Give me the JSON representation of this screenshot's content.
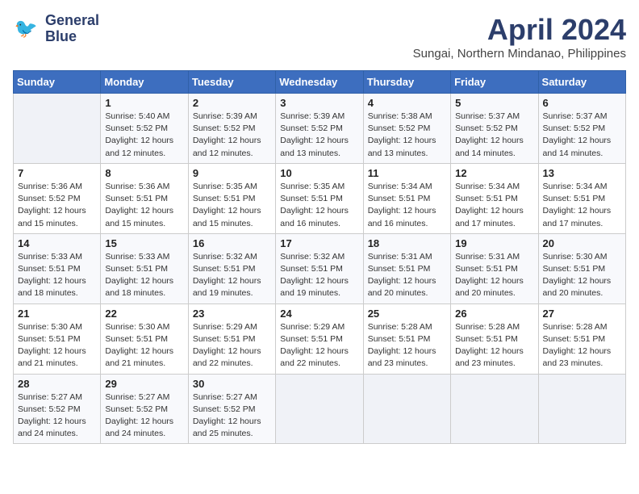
{
  "header": {
    "logo_line1": "General",
    "logo_line2": "Blue",
    "title": "April 2024",
    "subtitle": "Sungai, Northern Mindanao, Philippines"
  },
  "weekdays": [
    "Sunday",
    "Monday",
    "Tuesday",
    "Wednesday",
    "Thursday",
    "Friday",
    "Saturday"
  ],
  "weeks": [
    [
      {
        "num": "",
        "info": ""
      },
      {
        "num": "1",
        "info": "Sunrise: 5:40 AM\nSunset: 5:52 PM\nDaylight: 12 hours\nand 12 minutes."
      },
      {
        "num": "2",
        "info": "Sunrise: 5:39 AM\nSunset: 5:52 PM\nDaylight: 12 hours\nand 12 minutes."
      },
      {
        "num": "3",
        "info": "Sunrise: 5:39 AM\nSunset: 5:52 PM\nDaylight: 12 hours\nand 13 minutes."
      },
      {
        "num": "4",
        "info": "Sunrise: 5:38 AM\nSunset: 5:52 PM\nDaylight: 12 hours\nand 13 minutes."
      },
      {
        "num": "5",
        "info": "Sunrise: 5:37 AM\nSunset: 5:52 PM\nDaylight: 12 hours\nand 14 minutes."
      },
      {
        "num": "6",
        "info": "Sunrise: 5:37 AM\nSunset: 5:52 PM\nDaylight: 12 hours\nand 14 minutes."
      }
    ],
    [
      {
        "num": "7",
        "info": "Sunrise: 5:36 AM\nSunset: 5:52 PM\nDaylight: 12 hours\nand 15 minutes."
      },
      {
        "num": "8",
        "info": "Sunrise: 5:36 AM\nSunset: 5:51 PM\nDaylight: 12 hours\nand 15 minutes."
      },
      {
        "num": "9",
        "info": "Sunrise: 5:35 AM\nSunset: 5:51 PM\nDaylight: 12 hours\nand 15 minutes."
      },
      {
        "num": "10",
        "info": "Sunrise: 5:35 AM\nSunset: 5:51 PM\nDaylight: 12 hours\nand 16 minutes."
      },
      {
        "num": "11",
        "info": "Sunrise: 5:34 AM\nSunset: 5:51 PM\nDaylight: 12 hours\nand 16 minutes."
      },
      {
        "num": "12",
        "info": "Sunrise: 5:34 AM\nSunset: 5:51 PM\nDaylight: 12 hours\nand 17 minutes."
      },
      {
        "num": "13",
        "info": "Sunrise: 5:34 AM\nSunset: 5:51 PM\nDaylight: 12 hours\nand 17 minutes."
      }
    ],
    [
      {
        "num": "14",
        "info": "Sunrise: 5:33 AM\nSunset: 5:51 PM\nDaylight: 12 hours\nand 18 minutes."
      },
      {
        "num": "15",
        "info": "Sunrise: 5:33 AM\nSunset: 5:51 PM\nDaylight: 12 hours\nand 18 minutes."
      },
      {
        "num": "16",
        "info": "Sunrise: 5:32 AM\nSunset: 5:51 PM\nDaylight: 12 hours\nand 19 minutes."
      },
      {
        "num": "17",
        "info": "Sunrise: 5:32 AM\nSunset: 5:51 PM\nDaylight: 12 hours\nand 19 minutes."
      },
      {
        "num": "18",
        "info": "Sunrise: 5:31 AM\nSunset: 5:51 PM\nDaylight: 12 hours\nand 20 minutes."
      },
      {
        "num": "19",
        "info": "Sunrise: 5:31 AM\nSunset: 5:51 PM\nDaylight: 12 hours\nand 20 minutes."
      },
      {
        "num": "20",
        "info": "Sunrise: 5:30 AM\nSunset: 5:51 PM\nDaylight: 12 hours\nand 20 minutes."
      }
    ],
    [
      {
        "num": "21",
        "info": "Sunrise: 5:30 AM\nSunset: 5:51 PM\nDaylight: 12 hours\nand 21 minutes."
      },
      {
        "num": "22",
        "info": "Sunrise: 5:30 AM\nSunset: 5:51 PM\nDaylight: 12 hours\nand 21 minutes."
      },
      {
        "num": "23",
        "info": "Sunrise: 5:29 AM\nSunset: 5:51 PM\nDaylight: 12 hours\nand 22 minutes."
      },
      {
        "num": "24",
        "info": "Sunrise: 5:29 AM\nSunset: 5:51 PM\nDaylight: 12 hours\nand 22 minutes."
      },
      {
        "num": "25",
        "info": "Sunrise: 5:28 AM\nSunset: 5:51 PM\nDaylight: 12 hours\nand 23 minutes."
      },
      {
        "num": "26",
        "info": "Sunrise: 5:28 AM\nSunset: 5:51 PM\nDaylight: 12 hours\nand 23 minutes."
      },
      {
        "num": "27",
        "info": "Sunrise: 5:28 AM\nSunset: 5:51 PM\nDaylight: 12 hours\nand 23 minutes."
      }
    ],
    [
      {
        "num": "28",
        "info": "Sunrise: 5:27 AM\nSunset: 5:52 PM\nDaylight: 12 hours\nand 24 minutes."
      },
      {
        "num": "29",
        "info": "Sunrise: 5:27 AM\nSunset: 5:52 PM\nDaylight: 12 hours\nand 24 minutes."
      },
      {
        "num": "30",
        "info": "Sunrise: 5:27 AM\nSunset: 5:52 PM\nDaylight: 12 hours\nand 25 minutes."
      },
      {
        "num": "",
        "info": ""
      },
      {
        "num": "",
        "info": ""
      },
      {
        "num": "",
        "info": ""
      },
      {
        "num": "",
        "info": ""
      }
    ]
  ]
}
